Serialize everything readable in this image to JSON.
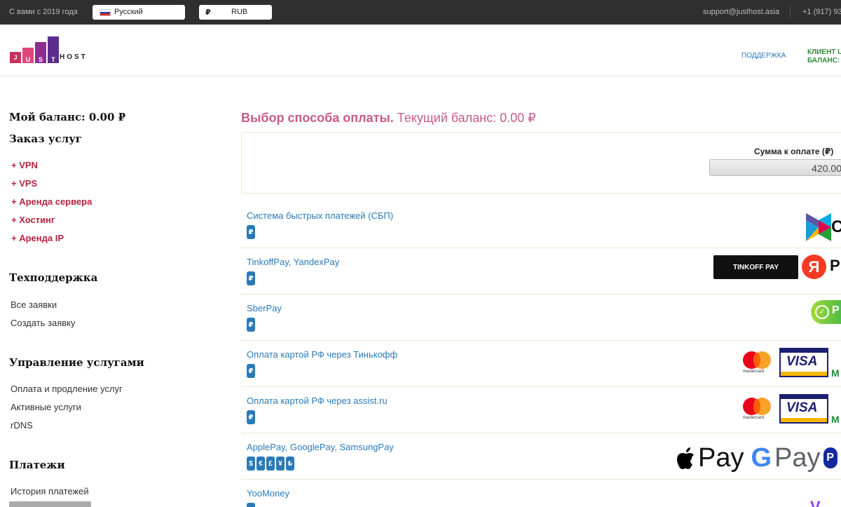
{
  "topbar": {
    "since": "С вами с 2019 года",
    "language": "Русский",
    "currency_symbol": "₽",
    "currency": "RUB",
    "email": "support@justhost.asia",
    "phone": "+1 (917) 93"
  },
  "header": {
    "logo_letters": [
      "J",
      "U",
      "S",
      "T"
    ],
    "logo_host": "HOST",
    "support": "ПОДДЕРЖКА",
    "client_line1": "КЛИЕНТ U",
    "client_line2": "БАЛАНС: "
  },
  "sidebar": {
    "balance": "Мой баланс: 0.00 ₽",
    "order_title": "Заказ услуг",
    "order_items": [
      "+ VPN",
      "+ VPS",
      "+ Аренда сервера",
      "+ Хостинг",
      "+ Аренда IP"
    ],
    "support_title": "Техподдержка",
    "support_items": [
      "Все заявки",
      "Создать заявку"
    ],
    "manage_title": "Управление услугами",
    "manage_items": [
      "Оплата и продление услуг",
      "Активные услуги",
      "rDNS"
    ],
    "payments_title": "Платежи",
    "payments_items": [
      "История платежей"
    ]
  },
  "main": {
    "title_bold": "Выбор способа оплаты.",
    "title_rest": " Текущий баланс: 0.00 ₽",
    "sum_label": "Сумма к оплате (₽)",
    "sum_value": "420.00",
    "methods": [
      {
        "name": "Система быстрых платежей (СБП)",
        "badges": [
          "₽"
        ],
        "logo": "sbp-logo"
      },
      {
        "name": "TinkoffPay, YandexPay",
        "badges": [
          "₽"
        ],
        "logo": "tinkoff-yandex-logo"
      },
      {
        "name": "SberPay",
        "badges": [
          "₽"
        ],
        "logo": "sberpay-logo"
      },
      {
        "name": "Оплата картой РФ через Тинькофф",
        "badges": [
          "₽"
        ],
        "logo": "cards-logo"
      },
      {
        "name": "Оплата картой РФ через assist.ru",
        "badges": [
          "₽"
        ],
        "logo": "cards-logo"
      },
      {
        "name": "ApplePay, GooglePay, SamsungPay",
        "badges": [
          "$",
          "€",
          "£",
          "¥",
          "₺"
        ],
        "logo": "wallet-pay-logo"
      },
      {
        "name": "YooMoney",
        "badges": [
          "₽"
        ],
        "logo": "yoomoney-logo"
      }
    ],
    "logo_text": {
      "tinkoff": "TINKOFF PAY",
      "ya": "Я",
      "ya_suffix": "P",
      "sber": "P",
      "mastercard": "mastercard",
      "visa": "VISA",
      "mir": "M",
      "apple_pay": "Pay",
      "google": "G",
      "google_pay": "Pay",
      "samsung": "P",
      "sbp_cut": "С",
      "yoo": "V"
    }
  }
}
